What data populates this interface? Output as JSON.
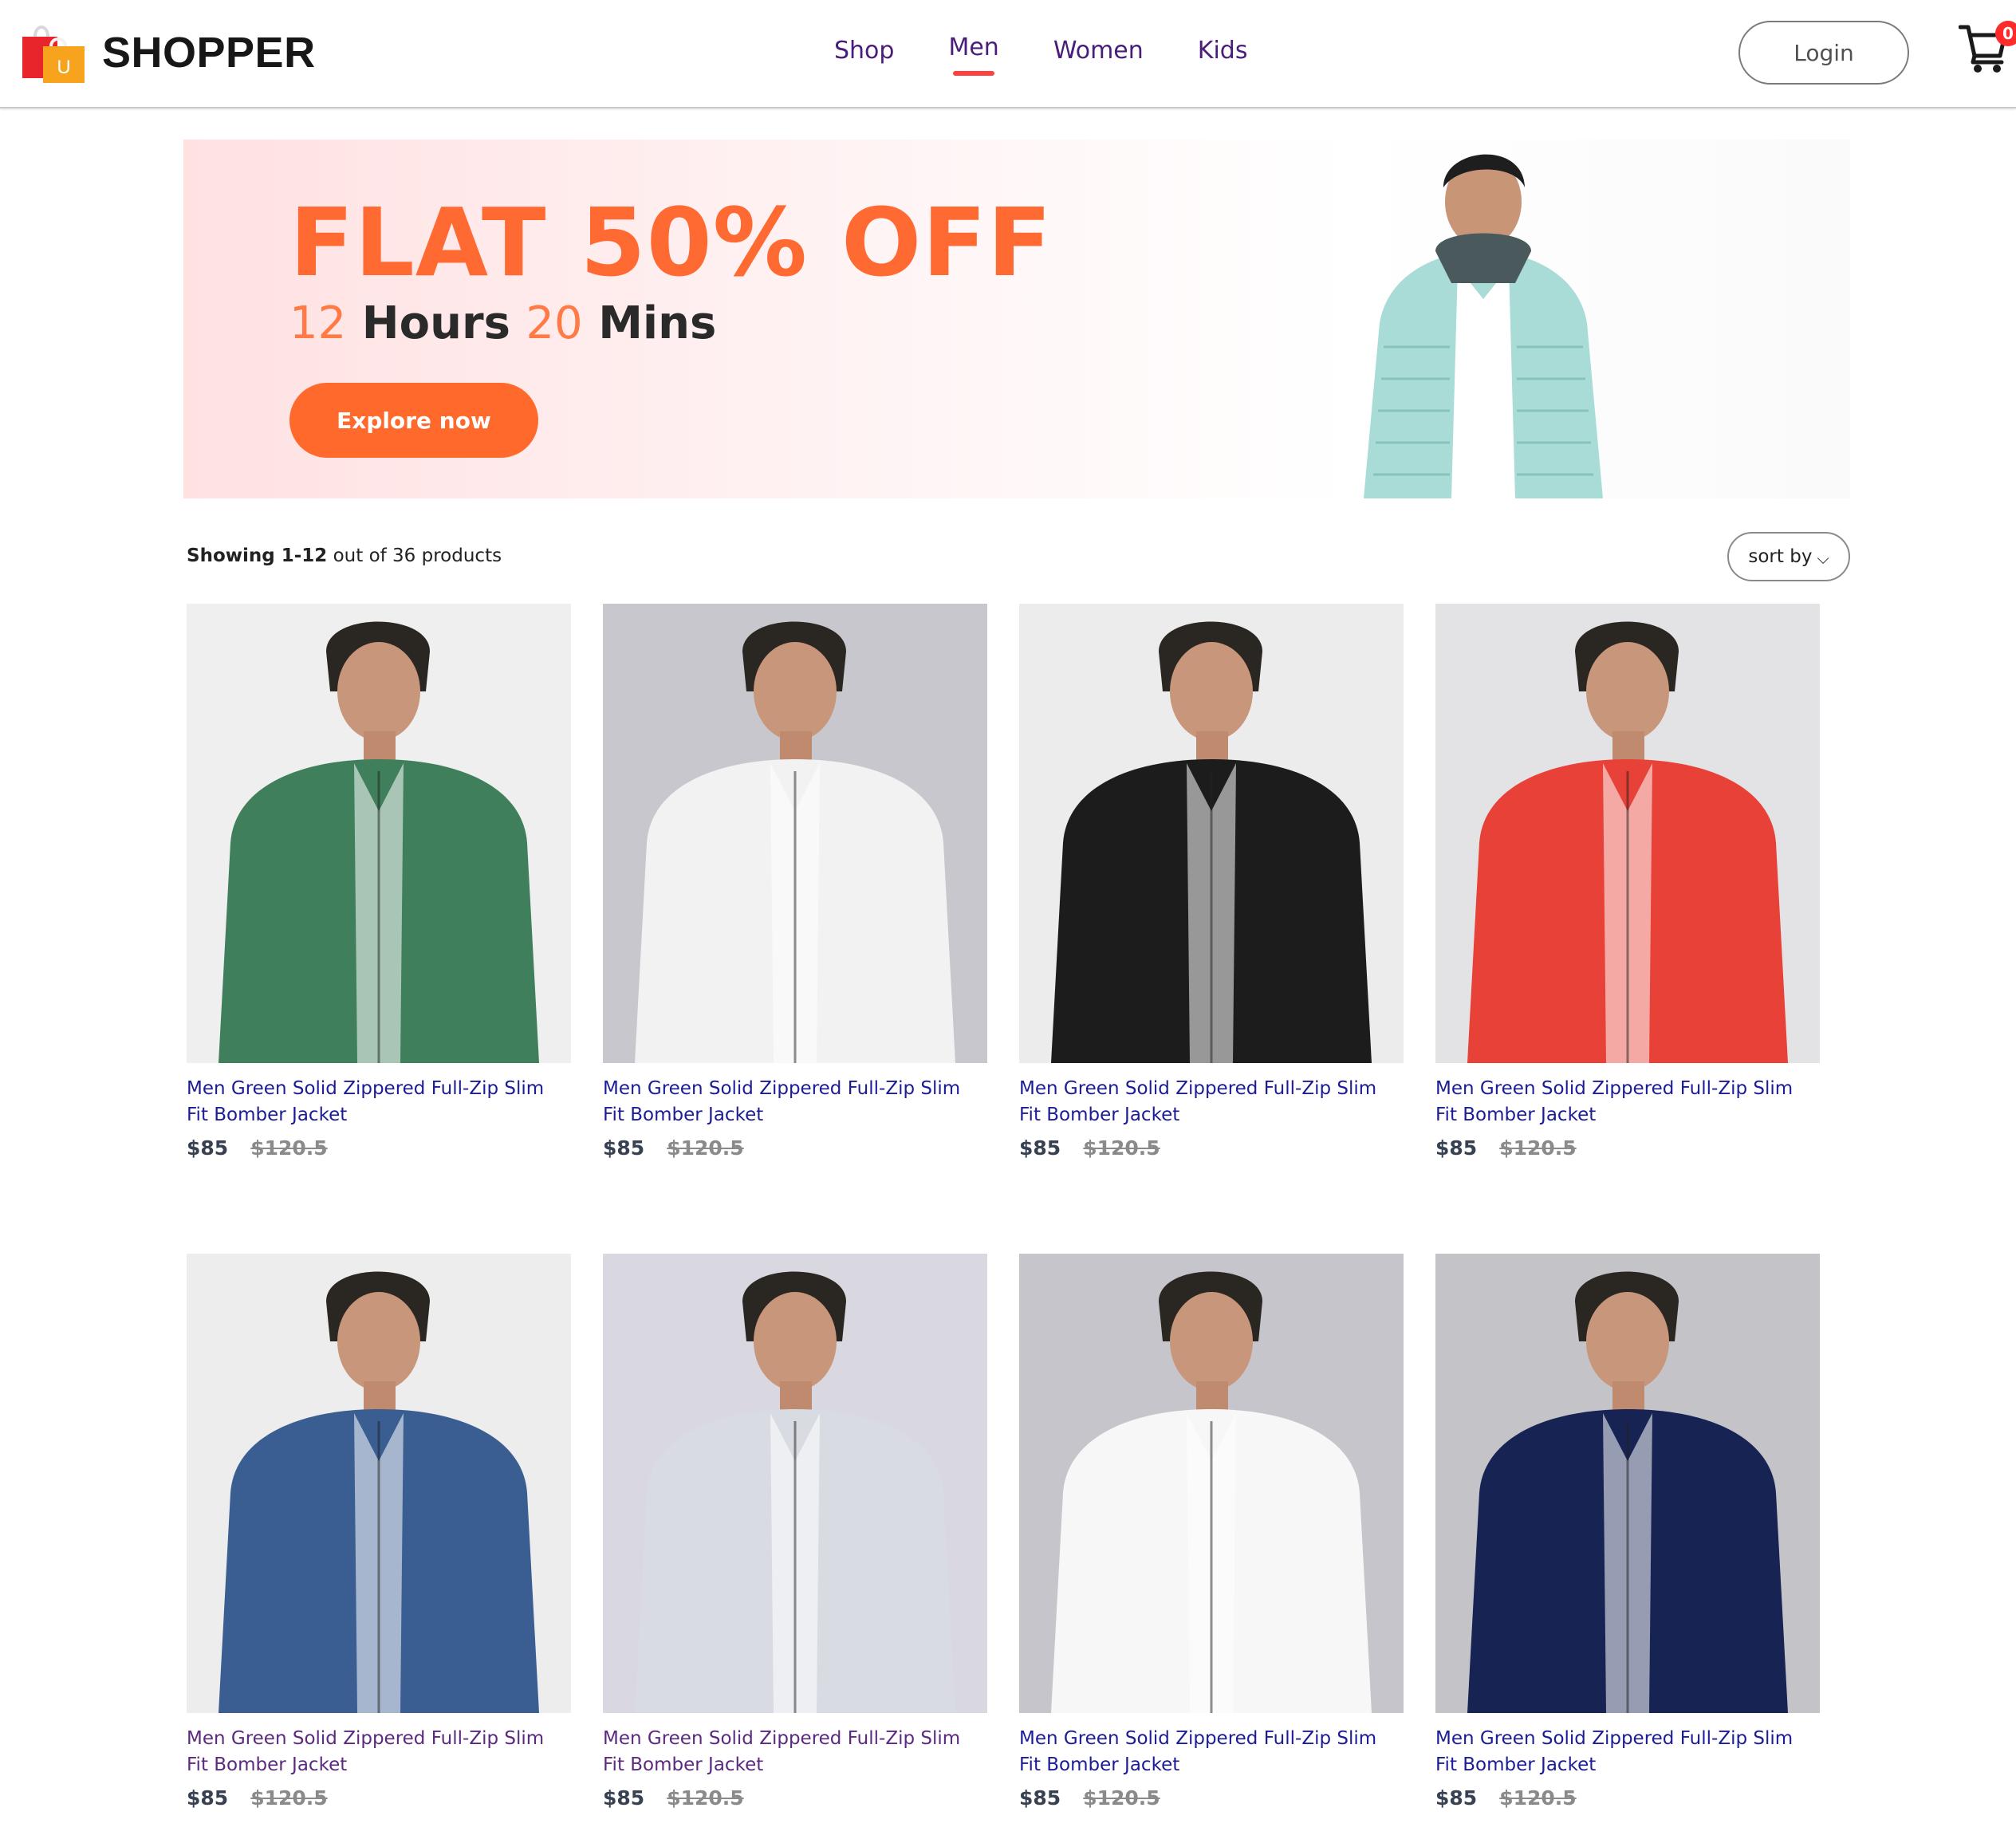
{
  "brand": {
    "name": "SHOPPER",
    "logo_letter": "U"
  },
  "nav": {
    "items": [
      {
        "label": "Shop"
      },
      {
        "label": "Men"
      },
      {
        "label": "Women"
      },
      {
        "label": "Kids"
      }
    ],
    "active": "Men",
    "login_label": "Login",
    "cart_count": "0"
  },
  "banner": {
    "headline": "FLAT 50% OFF",
    "hours_value": "12",
    "hours_label": "Hours",
    "mins_value": "20",
    "mins_label": "Mins",
    "button_label": "Explore now"
  },
  "listing": {
    "showing_range": "Showing 1-12",
    "showing_rest": "out of 36 products",
    "sort_label": "sort by",
    "sort_chevron": "chevron-down-icon"
  },
  "products": [
    {
      "name": "Men Green Solid Zippered Full-Zip Slim Fit Bomber Jacket",
      "price": "$85",
      "old_price": "$120.5",
      "jacket_color": "#3f7f5c",
      "bg_color": "#efefef"
    },
    {
      "name": "Men Green Solid Zippered Full-Zip Slim Fit Bomber Jacket",
      "price": "$85",
      "old_price": "$120.5",
      "jacket_color": "#f2f2f2",
      "bg_color": "#c7c7cd"
    },
    {
      "name": "Men Green Solid Zippered Full-Zip Slim Fit Bomber Jacket",
      "price": "$85",
      "old_price": "$120.5",
      "jacket_color": "#1c1c1c",
      "bg_color": "#ececec"
    },
    {
      "name": "Men Green Solid Zippered Full-Zip Slim Fit Bomber Jacket",
      "price": "$85",
      "old_price": "$120.5",
      "jacket_color": "#e84238",
      "bg_color": "#e3e3e6"
    },
    {
      "name": "Men Green Solid Zippered Full-Zip Slim Fit Bomber Jacket",
      "price": "$85",
      "old_price": "$120.5",
      "jacket_color": "#3a5e92",
      "bg_color": "#ededed"
    },
    {
      "name": "Men Green Solid Zippered Full-Zip Slim Fit Bomber Jacket",
      "price": "$85",
      "old_price": "$120.5",
      "jacket_color": "#d8dbe2",
      "bg_color": "#d9d8e0"
    },
    {
      "name": "Men Green Solid Zippered Full-Zip Slim Fit Bomber Jacket",
      "price": "$85",
      "old_price": "$120.5",
      "jacket_color": "#f7f7f7",
      "bg_color": "#c5c5cb"
    },
    {
      "name": "Men Green Solid Zippered Full-Zip Slim Fit Bomber Jacket",
      "price": "$85",
      "old_price": "$120.5",
      "jacket_color": "#172453",
      "bg_color": "#c3c3c8"
    }
  ],
  "colors": {
    "accent_orange": "#ff6a2c",
    "nav_active_underline": "#ff4141",
    "nav_text": "#4b1d7a",
    "product_name": "#1c1c94"
  }
}
